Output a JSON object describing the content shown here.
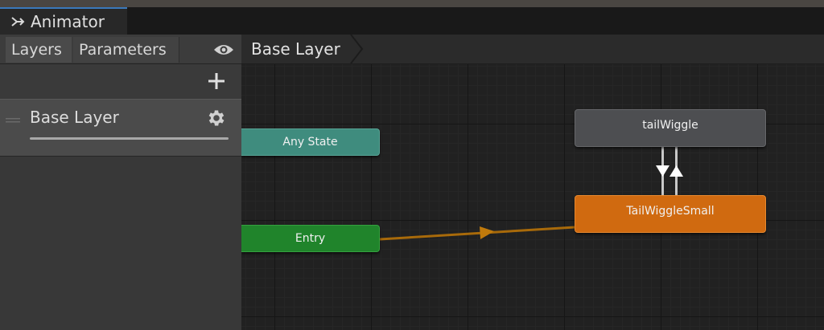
{
  "window": {
    "tab_title": "Animator",
    "tab_icon": "animator-icon"
  },
  "left_panel": {
    "tabs": [
      {
        "label": "Layers",
        "active": true
      },
      {
        "label": "Parameters",
        "active": false
      }
    ],
    "visibility_icon": "eye-icon",
    "add_icon": "plus-icon",
    "layers": [
      {
        "name": "Base Layer",
        "settings_icon": "gear-icon",
        "weight": 1.0
      }
    ]
  },
  "breadcrumb": {
    "items": [
      "Base Layer"
    ]
  },
  "graph": {
    "nodes": {
      "any_state": {
        "label": "Any State",
        "color": "#3f8c7e"
      },
      "entry": {
        "label": "Entry",
        "color": "#20842b"
      },
      "tail_wiggle": {
        "label": "tailWiggle",
        "color": "#4d4e51"
      },
      "tail_wiggle_small": {
        "label": "TailWiggleSmall",
        "color": "#d06a10",
        "default_state": true
      }
    },
    "transitions": [
      {
        "from": "Entry",
        "to": "TailWiggleSmall",
        "color": "#a86a0a"
      },
      {
        "from": "tailWiggle",
        "to": "TailWiggleSmall",
        "color": "#c8c8c8"
      },
      {
        "from": "TailWiggleSmall",
        "to": "tailWiggle",
        "color": "#c8c8c8"
      }
    ]
  },
  "colors": {
    "accent": "#3a79bb",
    "panel": "#383838",
    "graph_background": "#212121"
  }
}
